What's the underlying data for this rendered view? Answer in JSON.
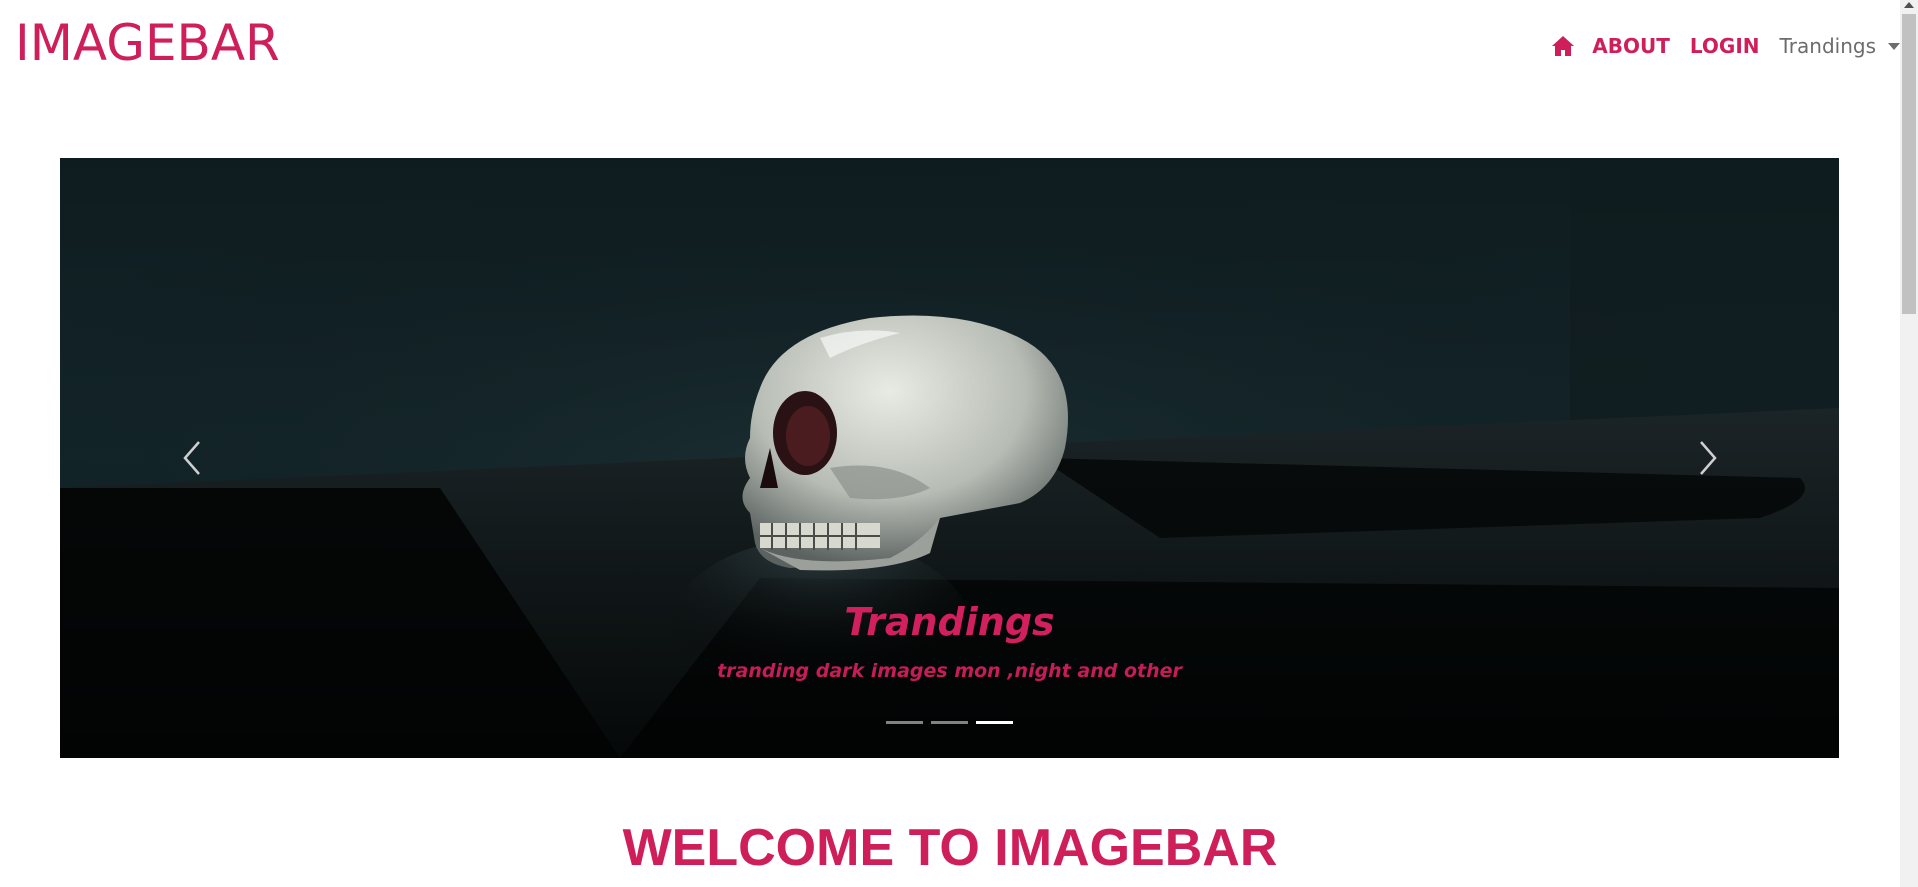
{
  "brand": {
    "name": "IMAGEBAR"
  },
  "nav": {
    "home_icon": "home-icon",
    "about_label": "ABOUT",
    "login_label": "LOGIN",
    "dropdown_label": "Trandings"
  },
  "carousel": {
    "slide_count": 3,
    "active_index": 2,
    "caption_title": "Trandings",
    "caption_text": "tranding dark images mon ,night and other",
    "image_subject": "skull"
  },
  "welcome": {
    "heading": "WELCOME TO IMAGEBAR"
  },
  "colors": {
    "accent": "#cf1f5b",
    "muted": "#6c6c6c",
    "carousel_bg": "#0b1416"
  }
}
